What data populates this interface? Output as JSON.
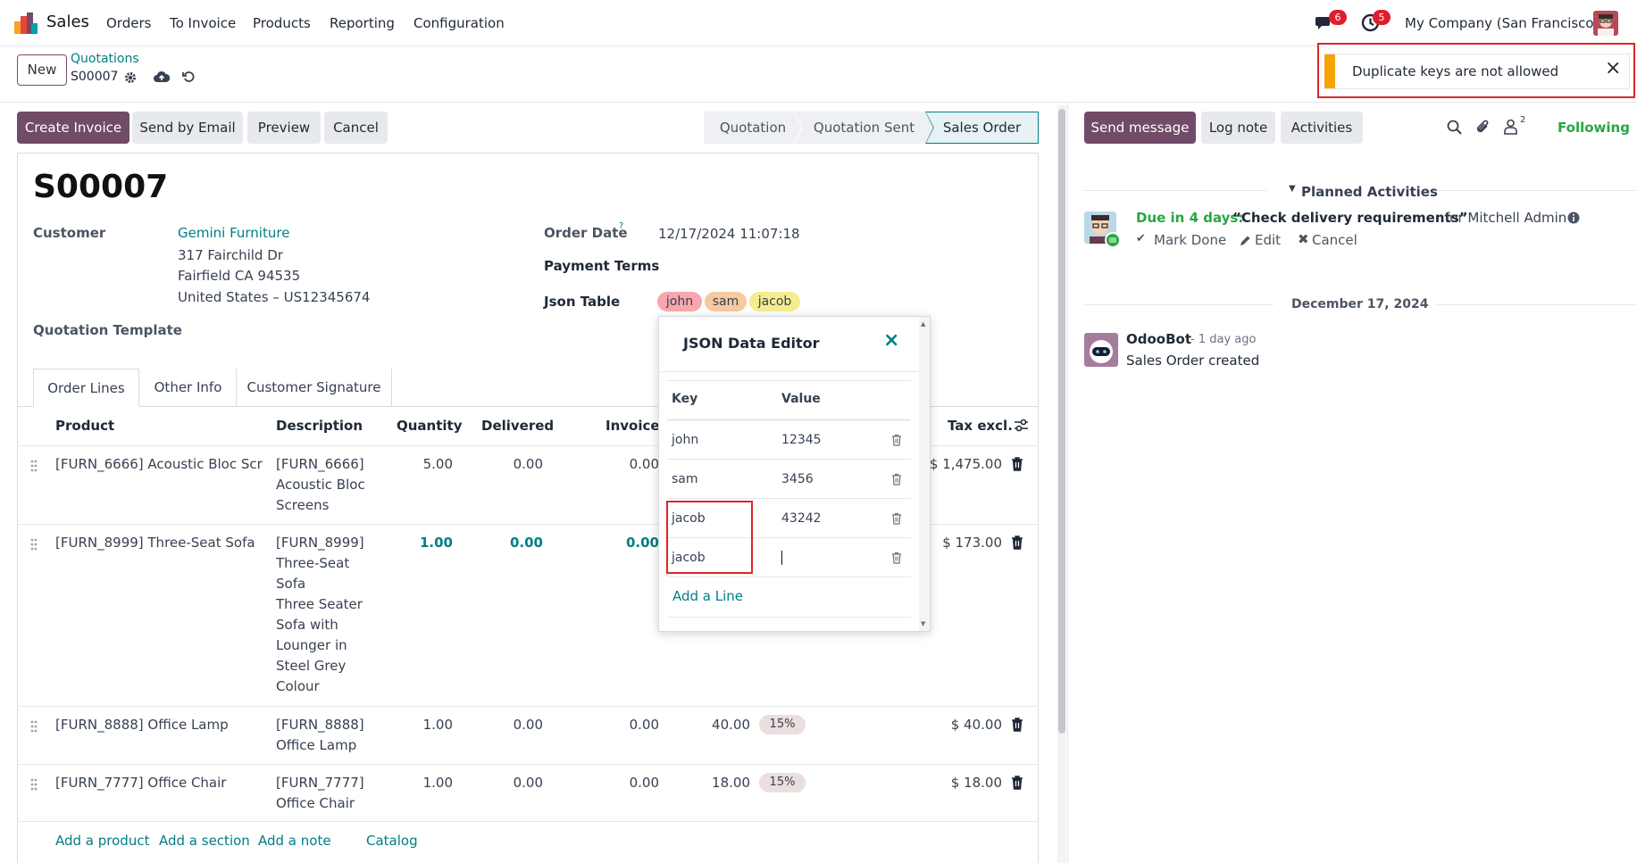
{
  "nav": {
    "app_name": "Sales",
    "menu": [
      "Orders",
      "To Invoice",
      "Products",
      "Reporting",
      "Configuration"
    ],
    "chat_badge": "6",
    "activity_badge": "5",
    "company": "My Company (San Francisco)"
  },
  "control": {
    "new_label": "New",
    "breadcrumb_parent": "Quotations",
    "record_name": "S00007"
  },
  "toast": {
    "message": "Duplicate keys are not allowed",
    "close": "×",
    "accent": "#f5a300"
  },
  "actions": {
    "create_invoice": "Create Invoice",
    "send_email": "Send by Email",
    "preview": "Preview",
    "cancel": "Cancel"
  },
  "status": {
    "stages": [
      "Quotation",
      "Quotation Sent",
      "Sales Order"
    ],
    "active": "Sales Order"
  },
  "form": {
    "title": "S00007",
    "customer_label": "Customer",
    "customer_name": "Gemini Furniture",
    "address": [
      "317 Fairchild Dr",
      "Fairfield CA 94535",
      "United States – US12345674"
    ],
    "template_label": "Quotation Template",
    "order_date_label": "Order Date",
    "order_date_help": "?",
    "order_date": "12/17/2024 11:07:18",
    "payment_terms_label": "Payment Terms",
    "json_table_label": "Json Table",
    "json_tags": [
      {
        "label": "john",
        "color": "#f7a7ad"
      },
      {
        "label": "sam",
        "color": "#f7c9a0"
      },
      {
        "label": "jacob",
        "color": "#f6ec8f"
      }
    ]
  },
  "tabs": [
    "Order Lines",
    "Other Info",
    "Customer Signature"
  ],
  "table": {
    "headers": {
      "product": "Product",
      "description": "Description",
      "quantity": "Quantity",
      "delivered": "Delivered",
      "invoiced": "Invoiced",
      "tax_excl": "Tax excl."
    },
    "rows": [
      {
        "product": "[FURN_6666] Acoustic Bloc Scr…",
        "description": [
          "[FURN_6666]",
          "Acoustic Bloc",
          "Screens"
        ],
        "quantity": "5.00",
        "delivered": "0.00",
        "invoiced": "0.00",
        "price": "",
        "tax": "",
        "subtotal": "$ 1,475.00"
      },
      {
        "product": "[FURN_8999] Three-Seat Sofa",
        "description": [
          "[FURN_8999]",
          "Three-Seat",
          "Sofa",
          "Three Seater",
          "Sofa with",
          "Lounger in",
          "Steel Grey",
          "Colour"
        ],
        "quantity": "1.00",
        "delivered": "0.00",
        "invoiced": "0.00",
        "price": "",
        "tax": "",
        "subtotal": "$ 173.00"
      },
      {
        "product": "[FURN_8888] Office Lamp",
        "description": [
          "[FURN_8888]",
          "Office Lamp"
        ],
        "quantity": "1.00",
        "delivered": "0.00",
        "invoiced": "0.00",
        "price": "40.00",
        "tax": "15%",
        "subtotal": "$ 40.00"
      },
      {
        "product": "[FURN_7777] Office Chair",
        "description": [
          "[FURN_7777]",
          "Office Chair"
        ],
        "quantity": "1.00",
        "delivered": "0.00",
        "invoiced": "0.00",
        "price": "18.00",
        "tax": "15%",
        "subtotal": "$ 18.00"
      }
    ],
    "add_links": [
      "Add a product",
      "Add a section",
      "Add a note",
      "Catalog"
    ]
  },
  "json_editor": {
    "title": "JSON Data Editor",
    "close": "×",
    "key_header": "Key",
    "value_header": "Value",
    "rows": [
      {
        "key": "john",
        "value": "12345"
      },
      {
        "key": "sam",
        "value": "3456"
      },
      {
        "key": "jacob",
        "value": "43242"
      },
      {
        "key": "jacob",
        "value": ""
      }
    ],
    "add_line": "Add a Line"
  },
  "chatter": {
    "send_message": "Send message",
    "log_note": "Log note",
    "activities": "Activities",
    "followers_count": "2",
    "following": "Following",
    "planned_title": "Planned Activities",
    "activity_due": "Due in 4 days:",
    "activity_name": "“Check delivery requirements”",
    "activity_for": "for Mitchell Admin",
    "mark_done": "Mark Done",
    "edit": "Edit",
    "cancel": "Cancel",
    "date_separator": "December 17, 2024",
    "msg_author": "OdooBot",
    "msg_time": "- 1 day ago",
    "msg_body": "Sales Order created"
  }
}
